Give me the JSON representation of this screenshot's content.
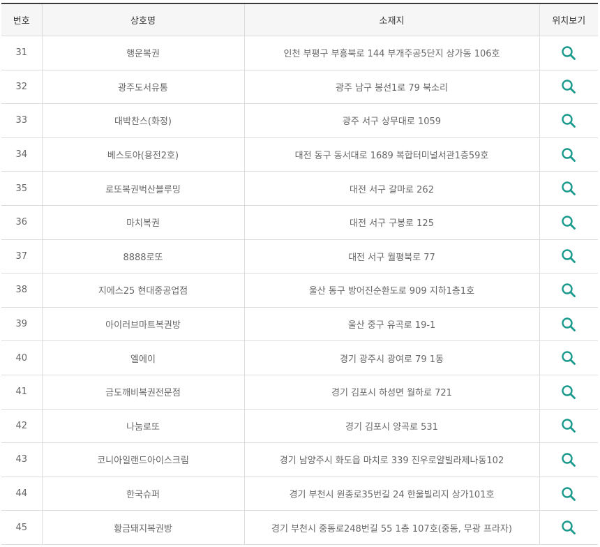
{
  "headers": {
    "num": "번호",
    "name": "상호명",
    "address": "소재지",
    "location": "위치보기"
  },
  "icons": {
    "location": "search-icon",
    "accent_color": "#1a9a8c"
  },
  "rows": [
    {
      "num": "31",
      "name": "행운복권",
      "address": "인천 부평구 부흥북로 144 부개주공5단지 상가동 106호"
    },
    {
      "num": "32",
      "name": "광주도서유통",
      "address": "광주 남구 봉선1로 79 북소리"
    },
    {
      "num": "33",
      "name": "대박찬스(화정)",
      "address": "광주 서구 상무대로 1059"
    },
    {
      "num": "34",
      "name": "베스토아(용전2호)",
      "address": "대전 동구 동서대로 1689 복합터미널서관1층59호"
    },
    {
      "num": "35",
      "name": "로또복권벅산블루밍",
      "address": "대전 서구 갈마로 262"
    },
    {
      "num": "36",
      "name": "마치복권",
      "address": "대전 서구 구봉로 125"
    },
    {
      "num": "37",
      "name": "8888로또",
      "address": "대전 서구 월평북로 77"
    },
    {
      "num": "38",
      "name": "지에스25 현대중공업점",
      "address": "울산 동구 방어진순환도로 909 지하1층1호"
    },
    {
      "num": "39",
      "name": "아이러브마트복권방",
      "address": "울산 중구 유곡로 19-1"
    },
    {
      "num": "40",
      "name": "엘에이",
      "address": "경기 광주시 광여로 79 1동"
    },
    {
      "num": "41",
      "name": "금도깨비복권전문점",
      "address": "경기 김포시 하성면 월하로 721"
    },
    {
      "num": "42",
      "name": "나눔로또",
      "address": "경기 김포시 양곡로 531"
    },
    {
      "num": "43",
      "name": "코니아일랜드아이스크림",
      "address": "경기 남양주시 화도읍 마치로 339 진우로얄빌라제나동102"
    },
    {
      "num": "44",
      "name": "한국슈퍼",
      "address": "경기 부천시 원종로35번길 24 한울빌리지 상가101호"
    },
    {
      "num": "45",
      "name": "황금돼지복권방",
      "address": "경기 부천시 중동로248번길 55 1층 107호(중동, 무광 프라자)"
    }
  ]
}
